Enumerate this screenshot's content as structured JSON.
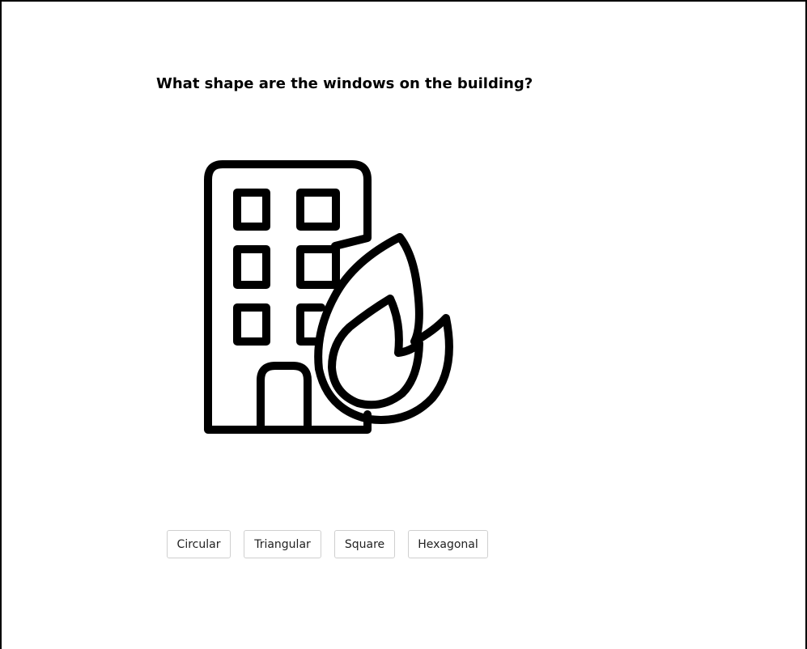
{
  "question": {
    "text": "What shape are the windows on the building?"
  },
  "illustration": {
    "icon": "building-on-fire-icon"
  },
  "answers": [
    {
      "label": "Circular"
    },
    {
      "label": "Triangular"
    },
    {
      "label": "Square"
    },
    {
      "label": "Hexagonal"
    }
  ]
}
